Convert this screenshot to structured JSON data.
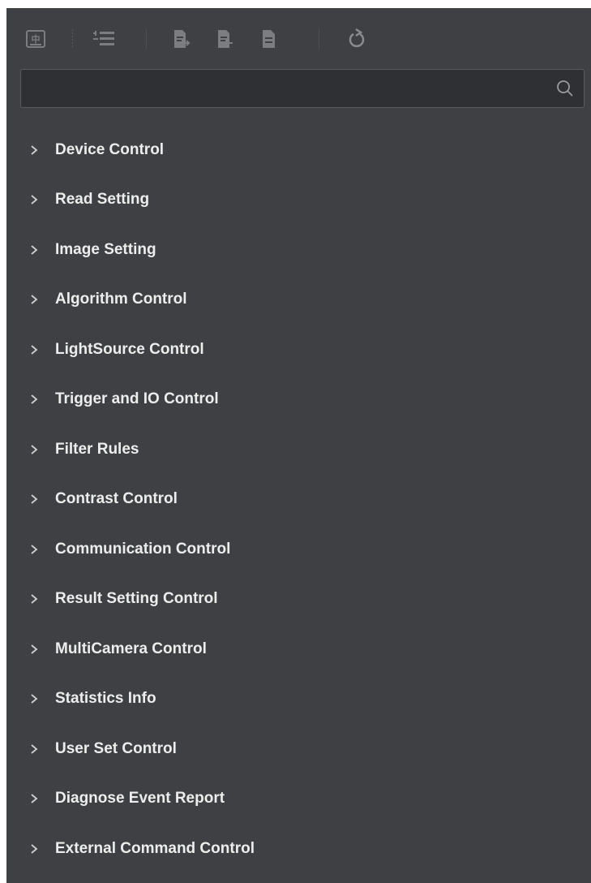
{
  "toolbar": {
    "buttons": [
      {
        "icon": "language-zh-icon",
        "glyph": "中"
      },
      {
        "icon": "list-indent-icon"
      },
      {
        "icon": "import-file-icon"
      },
      {
        "icon": "export-file-icon"
      },
      {
        "icon": "document-icon"
      },
      {
        "icon": "refresh-icon"
      }
    ]
  },
  "search": {
    "value": "",
    "placeholder": "",
    "icon": "search-icon"
  },
  "tree": {
    "items": [
      {
        "label": "Device Control"
      },
      {
        "label": "Read Setting"
      },
      {
        "label": "Image Setting"
      },
      {
        "label": "Algorithm Control"
      },
      {
        "label": "LightSource Control"
      },
      {
        "label": "Trigger and IO Control"
      },
      {
        "label": "Filter Rules"
      },
      {
        "label": "Contrast Control"
      },
      {
        "label": "Communication Control"
      },
      {
        "label": "Result Setting Control"
      },
      {
        "label": "MultiCamera Control"
      },
      {
        "label": "Statistics Info"
      },
      {
        "label": "User Set Control"
      },
      {
        "label": "Diagnose Event Report"
      },
      {
        "label": "External Command Control"
      }
    ]
  },
  "colors": {
    "panel_bg": "#3f4043",
    "search_bg": "#2f3033",
    "icon_gray": "#7c7d80",
    "text": "#ededed"
  }
}
